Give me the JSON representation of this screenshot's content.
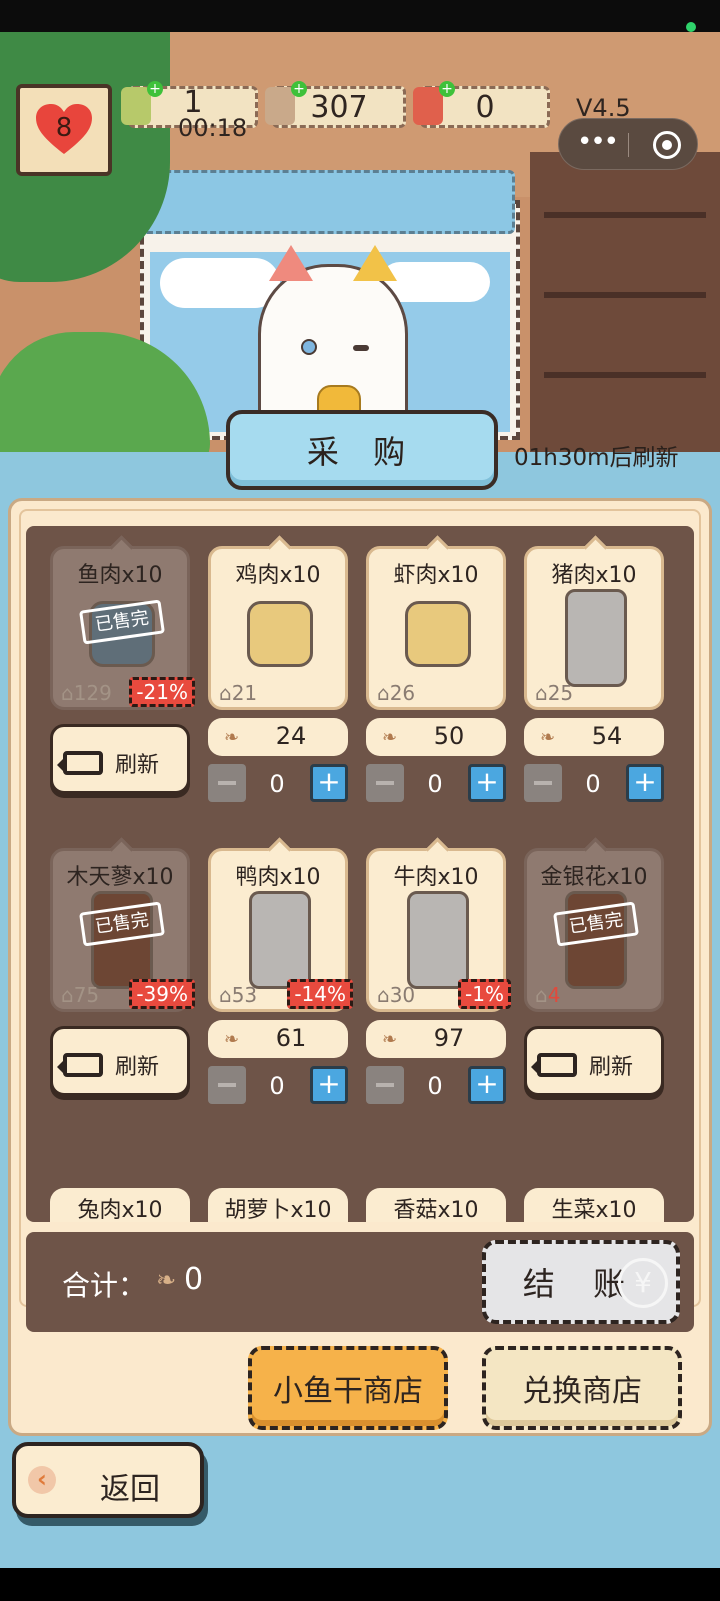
{
  "hud": {
    "hearts": "8",
    "resource1": "1",
    "timer": "00:18",
    "resource2": "307",
    "resource3": "0",
    "version": "V4.5"
  },
  "header": {
    "tab_label": "采 购",
    "refresh_timer": "01h30m后刷新"
  },
  "goods": [
    {
      "name": "鱼肉x10",
      "stock": "129",
      "discount": "-21%",
      "sold_out": "已售完",
      "refresh": "刷新"
    },
    {
      "name": "鸡肉x10",
      "stock": "21",
      "price": "24",
      "qty": "0"
    },
    {
      "name": "虾肉x10",
      "stock": "26",
      "price": "50",
      "qty": "0"
    },
    {
      "name": "猪肉x10",
      "stock": "25",
      "price": "54",
      "qty": "0"
    },
    {
      "name": "木天蓼x10",
      "stock": "75",
      "discount": "-39%",
      "sold_out": "已售完",
      "refresh": "刷新"
    },
    {
      "name": "鸭肉x10",
      "stock": "53",
      "discount": "-14%",
      "price": "61",
      "qty": "0"
    },
    {
      "name": "牛肉x10",
      "stock": "30",
      "discount": "-1%",
      "price": "97",
      "qty": "0"
    },
    {
      "name": "金银花x10",
      "stock": "4",
      "sold_out": "已售完",
      "refresh": "刷新"
    }
  ],
  "peek": [
    "兔肉x10",
    "胡萝卜x10",
    "香菇x10",
    "生菜x10"
  ],
  "total": {
    "label": "合计：",
    "value": "0"
  },
  "checkout_label": "结 账",
  "checkout_symbol": "¥",
  "shops": {
    "fish": "小鱼干商店",
    "exchange": "兑换商店"
  },
  "back_label": "返回",
  "colors": {
    "accent_blue": "#a6dbef",
    "discount_red": "#e84a3e",
    "plus_blue": "#4ba7e0"
  }
}
